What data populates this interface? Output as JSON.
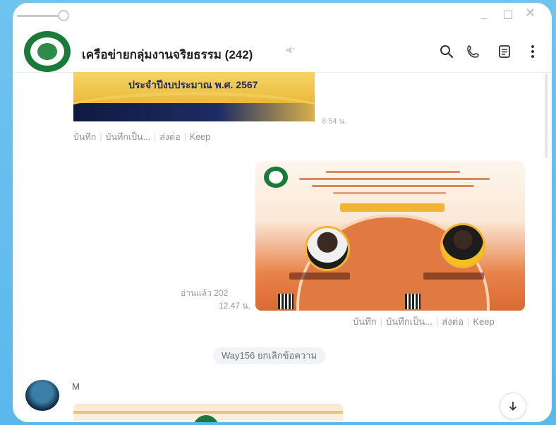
{
  "chat": {
    "title": "เครือข่ายกลุ่มงานจริยธรรม (242)",
    "mute_icon": "speaker-muted-icon"
  },
  "header_icons": [
    "search-icon",
    "phone-icon",
    "notes-icon",
    "more-icon"
  ],
  "messages": {
    "image1": {
      "caption": "ประจำปีงบประมาณ พ.ศ. 2567",
      "time": "8.54 น.",
      "actions": [
        "บันทึก",
        "บันทึกเป็น...",
        "ส่งต่อ",
        "Keep"
      ]
    },
    "image2": {
      "read": "อ่านแล้ว 202",
      "time": "12.47 น.",
      "actions": [
        "บันทึก",
        "บันทึกเป็น...",
        "ส่งต่อ",
        "Keep"
      ]
    },
    "system": "Way156 ยกเลิกข้อความ",
    "incoming": {
      "sender": "M"
    }
  },
  "colors": {
    "accent_green": "#1a7a3a",
    "background": "#5bb8ec"
  }
}
